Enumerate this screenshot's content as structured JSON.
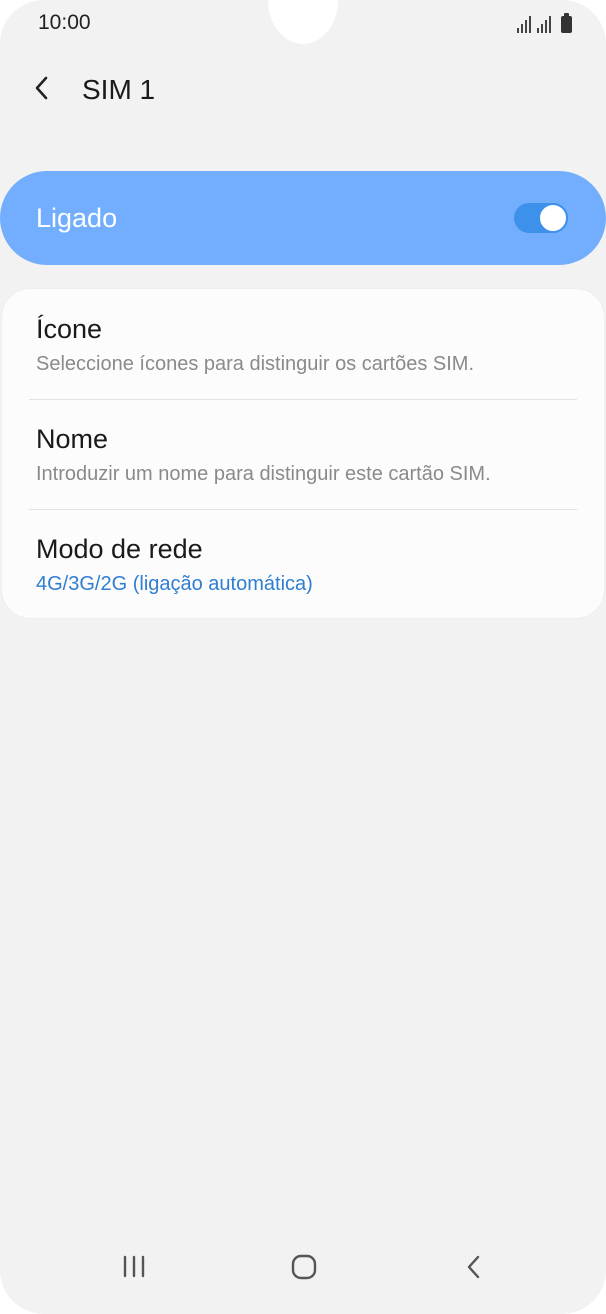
{
  "status_bar": {
    "time": "10:00"
  },
  "header": {
    "title": "SIM 1",
    "back_icon": "chevron-left-icon"
  },
  "master_switch": {
    "label": "Ligado",
    "enabled": true,
    "color": "#72aefd"
  },
  "settings": [
    {
      "title": "Ícone",
      "subtitle": "Seleccione ícones para distinguir os cartões SIM."
    },
    {
      "title": "Nome",
      "subtitle": "Introduzir um nome para distinguir este cartão SIM."
    },
    {
      "title": "Modo de rede",
      "subtitle": "4G/3G/2G (ligação automática)"
    }
  ],
  "colors": {
    "accent": "#2f7ed0",
    "background": "#f2f2f2"
  },
  "nav_bar": {
    "recents_icon": "recents-icon",
    "home_icon": "home-icon",
    "back_icon": "back-icon"
  }
}
